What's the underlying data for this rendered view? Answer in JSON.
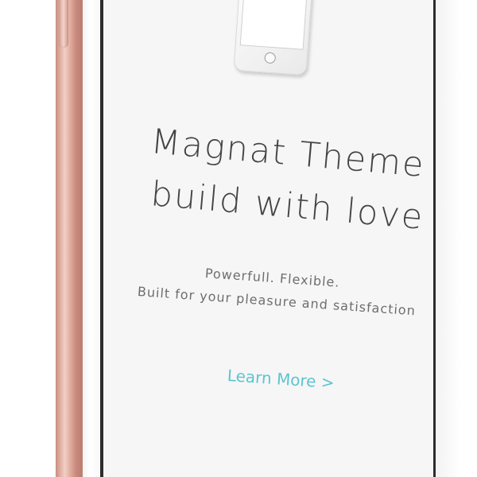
{
  "hero": {
    "title_line1": "Magnat Theme",
    "title_line2": "build with love",
    "subtitle_line1": "Powerfull. Flexible.",
    "subtitle_line2": "Built for your pleasure and satisfaction",
    "cta_label": "Learn More >"
  },
  "colors": {
    "accent": "#5ec4d0",
    "text": "#444444",
    "screen_bg": "#f6f6f6",
    "frame": "#e3b3a6"
  }
}
